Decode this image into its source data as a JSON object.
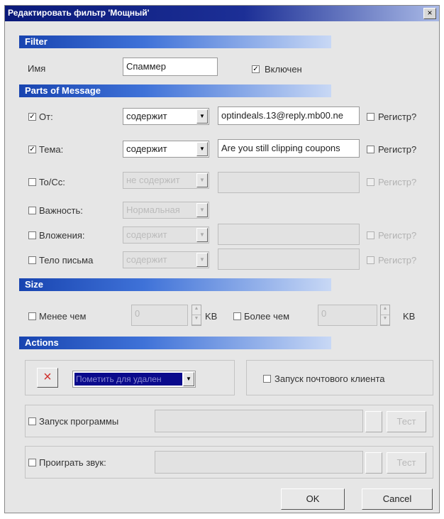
{
  "window": {
    "title": "Редактировать фильтр 'Мощный'",
    "close_glyph": "×"
  },
  "sections": {
    "filter": "Filter",
    "parts": "Parts of Message",
    "size": "Size",
    "actions": "Actions"
  },
  "filter": {
    "name_label": "Имя",
    "name_value": "Спаммер",
    "enabled_label": "Включен",
    "enabled": true
  },
  "parts": {
    "from": {
      "label": "От:",
      "checked": true,
      "operator": "содержит",
      "value": "optindeals.13@reply.mb00.ne",
      "case_label": "Регистр?"
    },
    "subject": {
      "label": "Тема:",
      "checked": true,
      "operator": "содержит",
      "value": "Are you still clipping coupons",
      "case_label": "Регистр?"
    },
    "tocc": {
      "label": "To/Cc:",
      "checked": false,
      "operator": "не содержит",
      "value": "",
      "case_label": "Регистр?"
    },
    "importance": {
      "label": "Важность:",
      "checked": false,
      "operator": "Нормальная"
    },
    "attachments": {
      "label": "Вложения:",
      "checked": false,
      "operator": "содержит",
      "value": "",
      "case_label": "Регистр?"
    },
    "body": {
      "label": "Тело письма",
      "checked": false,
      "operator": "содержит",
      "value": "",
      "case_label": "Регистр?"
    }
  },
  "size": {
    "less_label": "Менее чем",
    "less_value": "0",
    "less_unit": "KB",
    "more_label": "Более чем",
    "more_value": "0",
    "more_unit": "KB"
  },
  "actions": {
    "delete_glyph": "×",
    "action_select": "Пометить для удален",
    "launch_client_label": "Запуск почтового клиента",
    "run_program_label": "Запуск программы",
    "play_sound_label": "Проиграть звук:",
    "test_label": "Тест"
  },
  "buttons": {
    "ok": "OK",
    "cancel": "Cancel"
  },
  "colors": {
    "title_bar": "#0a1a7a",
    "section_header": "#1844b0",
    "dialog_bg": "#e6e6e6"
  }
}
